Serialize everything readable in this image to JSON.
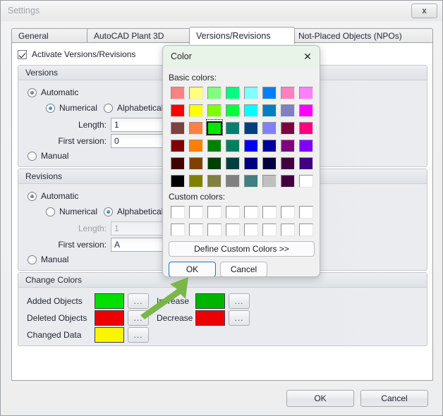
{
  "window": {
    "title": "Settings",
    "close_label": "x"
  },
  "tabs": [
    {
      "label": "General",
      "active": false
    },
    {
      "label": "AutoCAD Plant 3D",
      "active": false
    },
    {
      "label": "Versions/Revisions",
      "active": true
    },
    {
      "label": "Not-Placed Objects (NPOs)",
      "active": false
    }
  ],
  "panel": {
    "activate_checkbox_label": "Activate Versions/Revisions",
    "activate_checked": true,
    "versions": {
      "group_title": "Versions",
      "automatic_label": "Automatic",
      "numerical_label": "Numerical",
      "alphabetical_label": "Alphabetical",
      "length_label": "Length:",
      "length_value": "1",
      "first_version_label": "First version:",
      "first_version_value": "0",
      "manual_label": "Manual"
    },
    "revisions": {
      "group_title": "Revisions",
      "automatic_label": "Automatic",
      "numerical_label": "Numerical",
      "alphabetical_label": "Alphabetical",
      "length_label": "Length:",
      "length_value": "1",
      "first_version_label": "First version:",
      "first_version_value": "A",
      "manual_label": "Manual"
    },
    "change_colors": {
      "group_title": "Change Colors",
      "browse_label": "...",
      "left_rows": [
        {
          "label": "Added Objects",
          "color": "#00e000"
        },
        {
          "label": "Deleted Objects",
          "color": "#ef0000"
        },
        {
          "label": "Changed Data",
          "color": "#faf500"
        }
      ],
      "right_rows": [
        {
          "label": "Increase",
          "color": "#00b400"
        },
        {
          "label": "Decrease",
          "color": "#ef0000"
        }
      ]
    }
  },
  "footer": {
    "ok_label": "OK",
    "cancel_label": "Cancel"
  },
  "color_dialog": {
    "title": "Color",
    "close_label": "✕",
    "basic_colors_label": "Basic colors:",
    "custom_colors_label": "Custom colors:",
    "define_custom_label": "Define Custom Colors >>",
    "ok_label": "OK",
    "cancel_label": "Cancel",
    "selected_index": 18,
    "selected_color": "#00e800",
    "basic_colors": [
      "#ff8080",
      "#ffff80",
      "#80ff80",
      "#00ff80",
      "#80ffff",
      "#0080ff",
      "#ff80c0",
      "#ff80ff",
      "#ff0000",
      "#ffff00",
      "#80ff00",
      "#00ff40",
      "#00ffff",
      "#0080c0",
      "#8080c0",
      "#ff00ff",
      "#804040",
      "#ff8040",
      "#00e800",
      "#00806f",
      "#004080",
      "#8080ff",
      "#800040",
      "#ff0080",
      "#800000",
      "#ff8000",
      "#008000",
      "#008060",
      "#0000ff",
      "#0000a0",
      "#800080",
      "#8000ff",
      "#400000",
      "#804000",
      "#004000",
      "#004040",
      "#000080",
      "#000040",
      "#400040",
      "#400080",
      "#000000",
      "#808000",
      "#808040",
      "#808080",
      "#408080",
      "#c0c0c0",
      "#400040",
      "#ffffff"
    ],
    "custom_color_count": 16,
    "custom_color_value": "#ffffff"
  },
  "annotation": {
    "arrow_color": "#7ab648"
  }
}
